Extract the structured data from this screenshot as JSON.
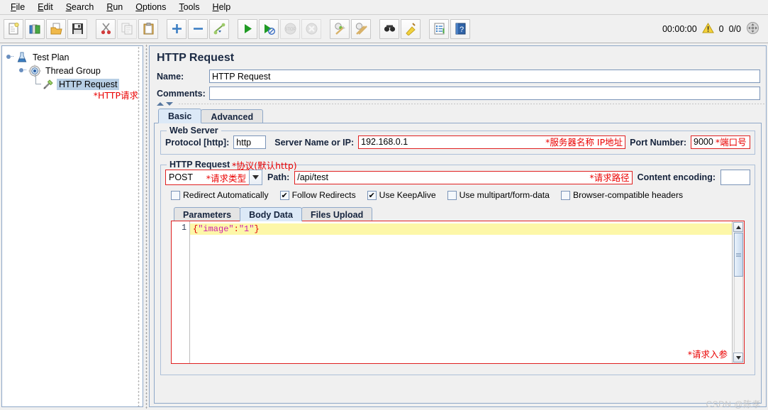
{
  "menubar": {
    "items": [
      {
        "label": "File",
        "mnemonic": "F"
      },
      {
        "label": "Edit",
        "mnemonic": "E"
      },
      {
        "label": "Search",
        "mnemonic": "S"
      },
      {
        "label": "Run",
        "mnemonic": "R"
      },
      {
        "label": "Options",
        "mnemonic": "O"
      },
      {
        "label": "Tools",
        "mnemonic": "T"
      },
      {
        "label": "Help",
        "mnemonic": "H"
      }
    ]
  },
  "toolbar": {
    "buttons": [
      {
        "name": "new-icon",
        "title": "New"
      },
      {
        "name": "templates-icon",
        "title": "Templates"
      },
      {
        "name": "open-icon",
        "title": "Open"
      },
      {
        "name": "save-icon",
        "title": "Save"
      },
      {
        "name": "cut-icon",
        "title": "Cut"
      },
      {
        "name": "copy-icon",
        "title": "Copy"
      },
      {
        "name": "paste-icon",
        "title": "Paste"
      },
      {
        "name": "expand-all-icon",
        "title": "Expand All"
      },
      {
        "name": "collapse-all-icon",
        "title": "Collapse All"
      },
      {
        "name": "toggle-icon",
        "title": "Toggle"
      },
      {
        "name": "start-icon",
        "title": "Start"
      },
      {
        "name": "start-no-pauses-icon",
        "title": "Start no pauses"
      },
      {
        "name": "stop-icon",
        "title": "Stop"
      },
      {
        "name": "shutdown-icon",
        "title": "Shutdown"
      },
      {
        "name": "clear-icon",
        "title": "Clear"
      },
      {
        "name": "clear-all-icon",
        "title": "Clear All"
      },
      {
        "name": "search-icon",
        "title": "Search"
      },
      {
        "name": "reset-search-icon",
        "title": "Reset Search"
      },
      {
        "name": "function-helper-icon",
        "title": "Function Helper Dialog"
      },
      {
        "name": "help-icon",
        "title": "Help"
      }
    ],
    "status": {
      "elapsed": "00:00:00",
      "warning_count": "0",
      "threads": "0/0"
    }
  },
  "tree": {
    "nodes": [
      {
        "label": "Test Plan",
        "icon": "test-plan-icon",
        "selected": false
      },
      {
        "label": "Thread Group",
        "icon": "thread-group-icon",
        "selected": false
      },
      {
        "label": "HTTP Request",
        "icon": "http-request-icon",
        "selected": true
      }
    ],
    "annotation": "*HTTP请求"
  },
  "panel": {
    "title": "HTTP Request",
    "name_label": "Name:",
    "name_value": "HTTP Request",
    "comments_label": "Comments:",
    "comments_value": "",
    "tabs": [
      {
        "label": "Basic",
        "active": true
      },
      {
        "label": "Advanced",
        "active": false
      }
    ],
    "web_server": {
      "group_title": "Web Server",
      "protocol_label": "Protocol [http]:",
      "protocol_value": "http",
      "protocol_annotation": "*协议(默认http)",
      "server_label": "Server Name or IP:",
      "server_value": "192.168.0.1",
      "server_annotation": "*服务器名称 IP地址",
      "port_label": "Port Number:",
      "port_value": "9000",
      "port_annotation": "*端口号"
    },
    "http_request": {
      "group_title": "HTTP Request",
      "method_value": "POST",
      "method_annotation": "*请求类型",
      "path_label": "Path:",
      "path_value": "/api/test",
      "path_annotation": "*请求路径",
      "encoding_label": "Content encoding:",
      "encoding_value": ""
    },
    "checkboxes": [
      {
        "label": "Redirect Automatically",
        "checked": false,
        "name": "redirect-automatically"
      },
      {
        "label": "Follow Redirects",
        "checked": true,
        "name": "follow-redirects"
      },
      {
        "label": "Use KeepAlive",
        "checked": true,
        "name": "use-keepalive"
      },
      {
        "label": "Use multipart/form-data",
        "checked": false,
        "name": "use-multipart-form-data"
      },
      {
        "label": "Browser-compatible headers",
        "checked": false,
        "name": "browser-compatible-headers"
      }
    ],
    "inner_tabs": [
      {
        "label": "Parameters",
        "active": false
      },
      {
        "label": "Body Data",
        "active": true
      },
      {
        "label": "Files Upload",
        "active": false
      }
    ],
    "body_editor": {
      "line_number": "1",
      "tokens": [
        {
          "text": "{",
          "type": "brace"
        },
        {
          "text": "\"image\"",
          "type": "string"
        },
        {
          "text": ":",
          "type": "colon"
        },
        {
          "text": "\"1\"",
          "type": "string"
        },
        {
          "text": "}",
          "type": "brace"
        }
      ],
      "annotation": "*请求入参"
    }
  },
  "watermark": "CSDN @陈孝",
  "colors": {
    "annotation_red": "#ea0000",
    "selection_blue": "#b8cfe5",
    "active_tab_blue": "#dce9f7",
    "panel_bg": "#f0f0f0",
    "code_highlight": "#fdf7a8"
  }
}
